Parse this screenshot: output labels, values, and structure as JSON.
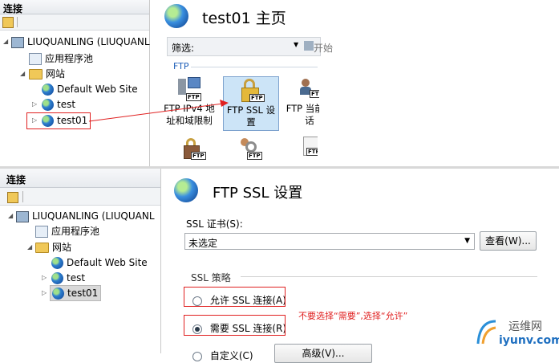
{
  "top": {
    "left_pane": {
      "header": "连接",
      "tree": [
        {
          "label": "LIUQUANLING (LIUQUANL",
          "icon": "server-icon"
        },
        {
          "label": "应用程序池",
          "icon": "app-pool-icon"
        },
        {
          "label": "网站",
          "icon": "sites-folder-icon"
        },
        {
          "label": "Default Web Site",
          "icon": "globe-icon"
        },
        {
          "label": "test",
          "icon": "globe-icon"
        },
        {
          "label": "test01",
          "icon": "globe-icon"
        }
      ]
    },
    "right_pane": {
      "title": "test01 主页",
      "filter_label": "筛选:",
      "go_label": "开始",
      "group_label": "FTP",
      "features": [
        {
          "label_line1": "FTP IPv4 地",
          "label_line2": "址和域限制",
          "icon": "ftp-ip-restrictions-icon"
        },
        {
          "label_line1": "FTP SSL 设",
          "label_line2": "置",
          "icon": "ftp-ssl-lock-icon"
        },
        {
          "label_line1": "FTP 当前会",
          "label_line2": "话",
          "icon": "ftp-current-sessions-icon"
        }
      ],
      "ftp_badge": "FTP"
    }
  },
  "bottom": {
    "left_pane": {
      "header": "连接",
      "tree": [
        {
          "label": "LIUQUANLING (LIUQUANL",
          "icon": "server-icon"
        },
        {
          "label": "应用程序池",
          "icon": "app-pool-icon"
        },
        {
          "label": "网站",
          "icon": "sites-folder-icon"
        },
        {
          "label": "Default Web Site",
          "icon": "globe-icon"
        },
        {
          "label": "test",
          "icon": "globe-icon"
        },
        {
          "label": "test01",
          "icon": "globe-icon"
        }
      ]
    },
    "right_pane": {
      "title": "FTP SSL 设置",
      "cert_label": "SSL 证书(S):",
      "cert_value": "未选定",
      "view_button": "查看(W)...",
      "policy_label": "SSL 策略",
      "options": [
        {
          "label": "允许 SSL 连接(A)",
          "selected": false
        },
        {
          "label": "需要 SSL 连接(R)",
          "selected": true
        },
        {
          "label": "自定义(C)",
          "selected": false
        }
      ],
      "advanced_button": "高级(V)...",
      "annotation": "不要选择“需要”,选择“允许”"
    }
  },
  "watermark": {
    "text_cn": "运维网",
    "text_en": "iyunv.com"
  },
  "colors": {
    "annotation_red": "#e02020",
    "group_blue": "#1f5fb8",
    "selection_bg": "#cce4f7"
  }
}
